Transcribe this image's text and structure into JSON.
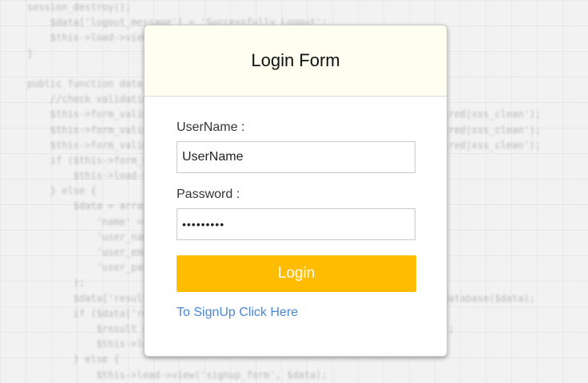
{
  "background": {
    "code_lines": [
      "session_destroy();",
      "    $data['logout_message'] = 'Successfully Logout';",
      "    $this->load->view('login_form', $data);",
      "}",
      "",
      "public function data_submit() {",
      "    //check validation for user input in SignUp form",
      "    $this->form_validation->set_rules('username', 'Username', 'trim|required|xss_clean');",
      "    $this->form_validation->set_rules('email_value', 'Email', 'trim|required|xss_clean');",
      "    $this->form_validation->set_rules('password', 'Password', 'trim|required|xss_clean');",
      "    if ($this->form_validation->run() == FALSE) {",
      "        $this->load->view('registration_form');",
      "    } else {",
      "        $data = array(",
      "            'name' => $this->input->post('name'),",
      "            'user_name' => $this->input->post('username'),",
      "            'user_email' => $this->input->post('email_value'),",
      "            'user_password' => $this->input->post('password')",
      "        );",
      "        $data['result'] = $this->login_database->registration_insert_in_database($data);",
      "        if ($data['result'] == TRUE) {",
      "            $result = $this->login_database->read_user_information($data);",
      "            $this->load->view('login_form', $data);",
      "        } else {",
      "            $this->load->view('signup_form', $data);"
    ]
  },
  "form": {
    "title": "Login Form",
    "username_label": "UserName :",
    "username_value": "UserName",
    "password_label": "Password :",
    "password_value": "password1",
    "login_button": "Login",
    "signup_link": "To SignUp Click Here"
  },
  "colors": {
    "header_bg": "#fefff0",
    "button_bg": "#ffbc00",
    "link": "#4a86d6"
  }
}
